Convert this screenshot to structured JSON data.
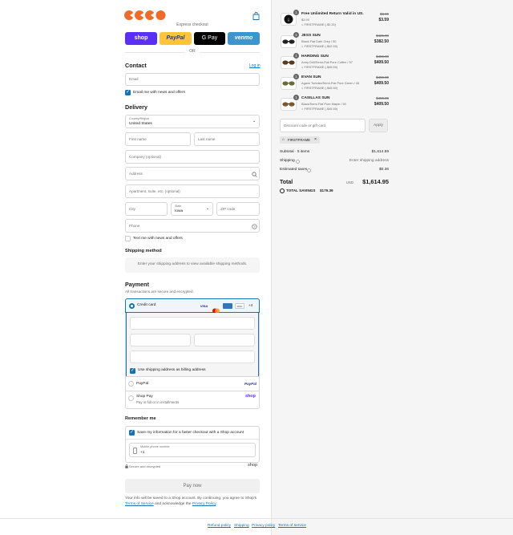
{
  "express": {
    "label": "Express checkout",
    "shop": "shop",
    "paypal": "PayPal",
    "gpay": "G Pay",
    "venmo": "venmo",
    "or": "OR"
  },
  "contact": {
    "heading": "Contact",
    "login": "Log in",
    "email_placeholder": "Email",
    "news_label": "Email me with news and offers"
  },
  "delivery": {
    "heading": "Delivery",
    "country_label": "Country/Region",
    "country_value": "United States",
    "first_name": "First name",
    "last_name": "Last name",
    "company": "Company (optional)",
    "address": "Address",
    "apartment": "Apartment, suite, etc. (optional)",
    "city": "City",
    "state_label": "State",
    "state_value": "Iowa",
    "zip": "ZIP code",
    "phone": "Phone",
    "text_label": "Text me with news and offers"
  },
  "shipping": {
    "heading": "Shipping method",
    "note": "Enter your shipping address to view available shipping methods."
  },
  "payment": {
    "heading": "Payment",
    "note": "All transactions are secure and encrypted.",
    "credit_card": "Credit card",
    "card_more": "+4",
    "billing_label": "Use shipping address as billing address",
    "paypal": "PayPal",
    "paypal_logo": "PayPal",
    "shop_pay": "Shop Pay",
    "shop_pay_sub": "Pay in full or in installments",
    "shop_logo": "shop"
  },
  "remember": {
    "heading": "Remember me",
    "save_label": "Save my information for a faster checkout with a Shop account",
    "phone_label": "Mobile phone number",
    "phone_value": "+1",
    "secure": "Secure and encrypted",
    "shop_logo": "shop"
  },
  "pay_button": "Pay now",
  "legal": {
    "line1": "Your info will be saved to a Shop account. By continuing, you agree to Shop's",
    "terms": "Terms of Service",
    "mid": "and acknowledge the",
    "privacy": "Privacy Policy",
    "end": "."
  },
  "footer": {
    "refund": "Refund policy",
    "shipping": "Shipping",
    "privacy": "Privacy policy",
    "terms": "Terms of service"
  },
  "cart": {
    "items": [
      {
        "qty": "1",
        "title": "Free Unlimited Return Valid in US.",
        "variant": "$3.99",
        "discount": "FIRSTFRAME (-$0.20)",
        "orig": "$3.99",
        "price": "$3.59"
      },
      {
        "qty": "1",
        "title": "JESS SUN",
        "variant": "Black Flat Dark Grey / 50",
        "discount": "FIRSTFRAME (-$42.50)",
        "orig": "$425.00",
        "price": "$382.50"
      },
      {
        "qty": "1",
        "title": "HARDING SUN",
        "variant": "Army Drill/Semi-Flat Pure Coffee / 57",
        "discount": "FIRSTFRAME (-$45.50)",
        "orig": "$455.00",
        "price": "$409.50"
      },
      {
        "qty": "1",
        "title": "EVAN SUN",
        "variant": "Agave Tortoise/Semi-Flat Pure Green / 45",
        "discount": "FIRSTFRAME (-$45.50)",
        "orig": "$455.00",
        "price": "$409.50"
      },
      {
        "qty": "1",
        "title": "CASILLAS SUN",
        "variant": "Black/Semi-Flat Pure Maple / 50",
        "discount": "FIRSTFRAME (-$45.50)",
        "orig": "$455.00",
        "price": "$409.50"
      }
    ],
    "discount_placeholder": "Discount code or gift card",
    "apply": "Apply",
    "code": "FIRSTFRAME",
    "subtotal_label": "Subtotal · 5 items",
    "subtotal": "$1,614.59",
    "shipping_label": "Shipping",
    "shipping_value": "Enter shipping address",
    "taxes_label": "Estimated taxes",
    "taxes": "$0.36",
    "total_label": "Total",
    "currency": "USD",
    "total": "$1,614.95",
    "savings_label": "TOTAL SAVINGS",
    "savings": "$179.39"
  },
  "colors": {
    "accent": "#1773b0",
    "logo": "#ef6b28",
    "shop": "#5a31f4",
    "paypal": "#ffc439",
    "venmo": "#3d95ce"
  }
}
